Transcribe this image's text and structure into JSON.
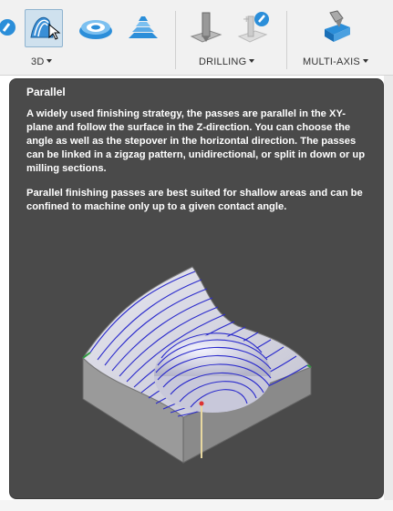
{
  "toolbar": {
    "groups": [
      {
        "label": "3D"
      },
      {
        "label": "DRILLING"
      },
      {
        "label": "MULTI-AXIS"
      }
    ]
  },
  "tooltip": {
    "title": "Parallel",
    "paragraphs": [
      "A widely used finishing strategy, the passes are parallel in the XY-plane and follow the surface in the Z-direction. You can choose the angle as well as the stepover in the horizontal direction. The passes can be linked in a zigzag pattern, unidirectional, or split in down or up milling sections.",
      "Parallel finishing passes are best suited for shallow areas and can be confined to machine only up to a given contact angle."
    ]
  },
  "icons": [
    "probe-icon",
    "parallel-icon",
    "pocket-clearing-icon",
    "waterline-icon",
    "drill-icon",
    "hole-recognition-icon",
    "multi-axis-icon"
  ],
  "colors": {
    "tooltip_bg": "#4a4a4a",
    "toolpath": "#2a2acc",
    "part": "#c8c8c8",
    "active_highlight": "#cfe1ee"
  }
}
